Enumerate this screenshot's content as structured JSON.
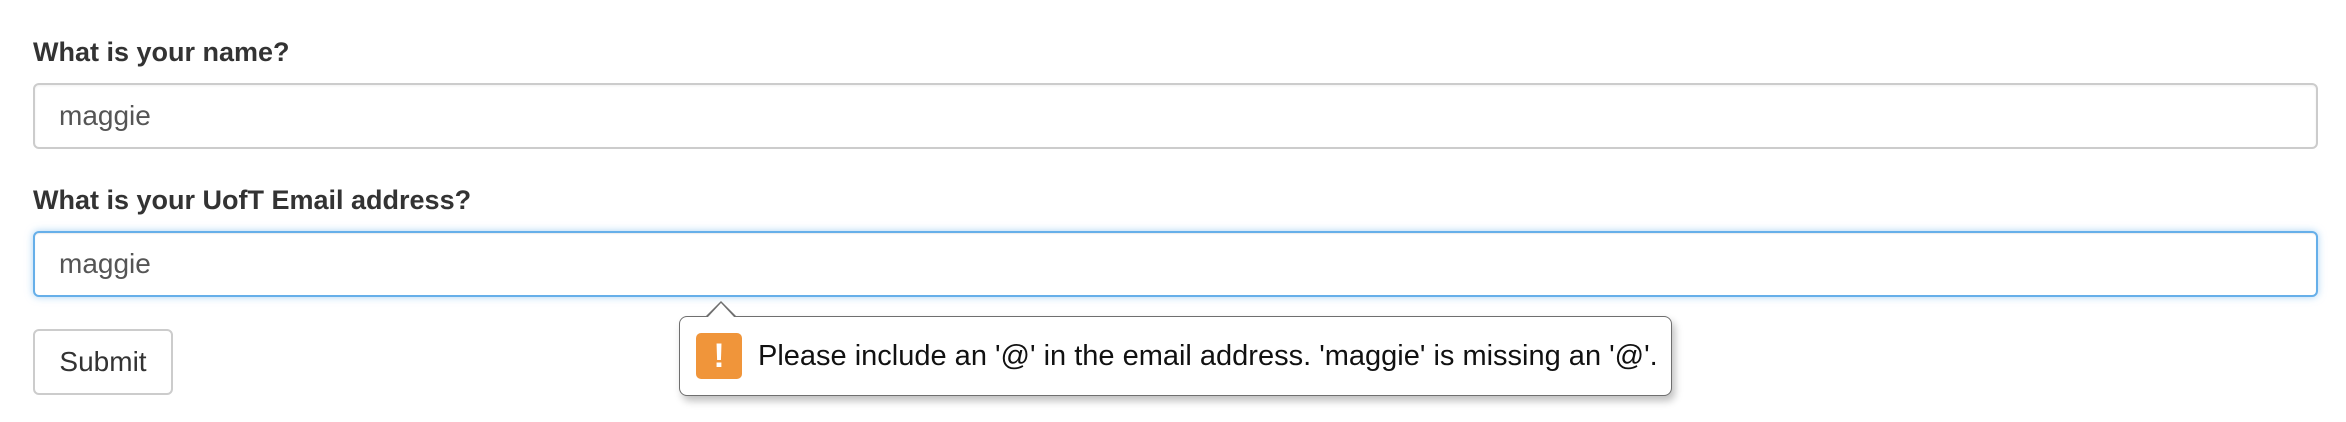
{
  "form": {
    "name_label": "What is your name?",
    "name_value": "maggie",
    "email_label": "What is your UofT Email address?",
    "email_value": "maggie",
    "submit_label": "Submit"
  },
  "validation_tooltip": {
    "icon": "warning-icon",
    "icon_glyph": "!",
    "icon_color": "#f0953a",
    "message": "Please include an '@' in the email address. 'maggie' is missing an '@'."
  },
  "colors": {
    "focus_border": "#66afe9",
    "input_border": "#cccccc",
    "label_text": "#333333"
  }
}
